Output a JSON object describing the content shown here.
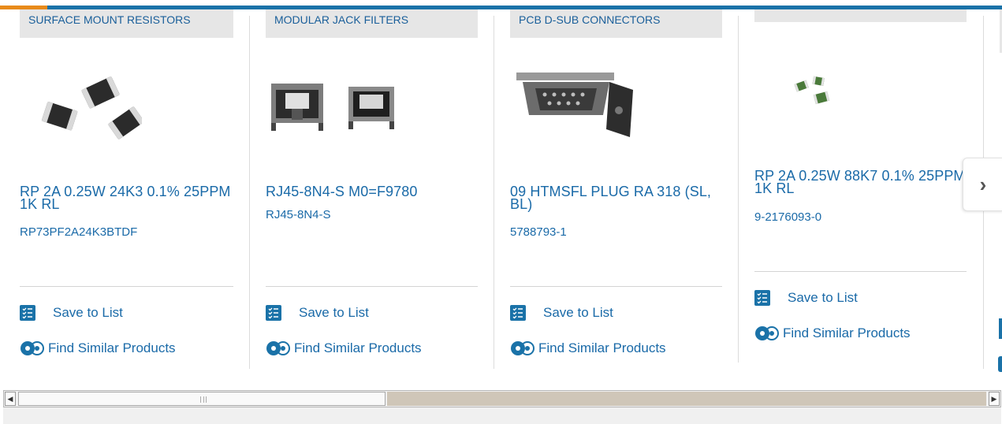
{
  "carousel": {
    "cards": [
      {
        "category": "SURFACE MOUNT RESISTORS",
        "title": "RP 2A 0.25W 24K3 0.1% 25PPM 1K RL",
        "part_number": "RP73PF2A24K3BTDF",
        "save_label": "Save to List",
        "similar_label": "Find Similar Products"
      },
      {
        "category": "MODULAR JACK FILTERS",
        "title": "RJ45-8N4-S M0=F9780",
        "part_number": "RJ45-8N4-S",
        "save_label": "Save to List",
        "similar_label": "Find Similar Products"
      },
      {
        "category": "PCB D-SUB CONNECTORS",
        "title": "09 HTMSFL PLUG RA 318 (SL, BL)",
        "part_number": "5788793-1",
        "save_label": "Save to List",
        "similar_label": "Find Similar Products"
      },
      {
        "category": "",
        "title": "RP 2A 0.25W 88K7 0.1% 25PPM 1K RL",
        "part_number": "9-2176093-0",
        "save_label": "Save to List",
        "similar_label": "Find Similar Products"
      }
    ],
    "next_icon": "chevron-right-icon"
  },
  "colors": {
    "accent": "#e88a1a",
    "brand": "#1a72a8",
    "link": "#1a6aa8"
  }
}
